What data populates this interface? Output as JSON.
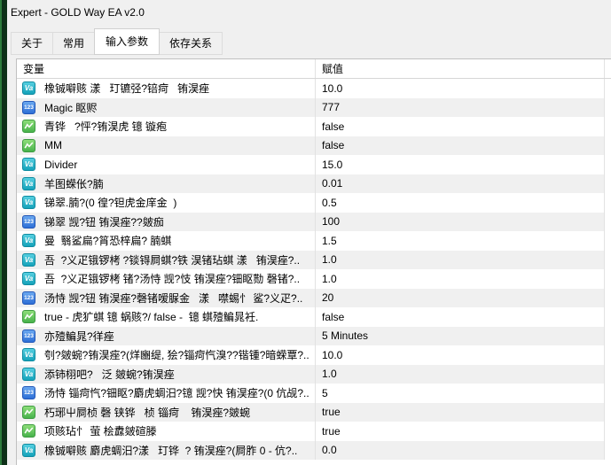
{
  "window": {
    "title": "Expert - GOLD Way EA v2.0"
  },
  "tabs": [
    {
      "label": "关于",
      "active": false
    },
    {
      "label": "常用",
      "active": false
    },
    {
      "label": "输入参数",
      "active": true
    },
    {
      "label": "依存关系",
      "active": false
    }
  ],
  "icons": {
    "double_label": "Va",
    "int_label": "123",
    "bool_label": "zigzag-line"
  },
  "table": {
    "headers": {
      "variable": "变量",
      "value": "赋值"
    },
    "rows": [
      {
        "type": "double",
        "name": "橡铖噼赅 漾   玎镳弪?锫疴   铕淏痤",
        "value": "10.0"
      },
      {
        "type": "int",
        "name": "Magic 眍赆",
        "value": "777"
      },
      {
        "type": "bool",
        "name": "青铧   ?怦?铕淏虎 镱 镟疱",
        "value": "false"
      },
      {
        "type": "bool",
        "name": "MM",
        "value": "false"
      },
      {
        "type": "double",
        "name": "Divider",
        "value": "15.0"
      },
      {
        "type": "double",
        "name": "羊图蝾伥?腩",
        "value": "0.01"
      },
      {
        "type": "double",
        "name": "锑翠.腩?(0 徨?钽虎金庠金  )",
        "value": "0.5"
      },
      {
        "type": "int",
        "name": "锑翠 觊?钮 铕淏痤??皴痂",
        "value": "100"
      },
      {
        "type": "double",
        "name": "曼  翳鲨扁?筲恐梓扁? 腩蜞",
        "value": "1.5"
      },
      {
        "type": "double",
        "name": "吾  ?义疋锇锣栲 ?锬锝屙蜞?铁 淏锗玷蜞 漾   铕淏痤?..",
        "value": "1.0"
      },
      {
        "type": "double",
        "name": "吾  ?义疋锇锣栲 锗?汤恃 觊?忮 铕淏痤?钿眍勚 磬锗?..",
        "value": "1.0"
      },
      {
        "type": "int",
        "name": "汤恃 觊?钮 铕淏痤?磬锗嗳脲金   漾   噤蜴忄 鲨?义疋?..",
        "value": "20"
      },
      {
        "type": "bool",
        "name": "true - 虎犷蜞 镱 蜗赅?/ false -  镱 蜞殪鳊晁衽.",
        "value": "false"
      },
      {
        "type": "int",
        "name": "亦殪鳊晁?徉痤",
        "value": "5 Minutes"
      },
      {
        "type": "double",
        "name": "刳?皴蜿?铕淏痤?(烊豳缇, 狯?锱疴忾溴??锴锺?暗蝾覃?..",
        "value": "10.0"
      },
      {
        "type": "double",
        "name": "添铈栩吧?   泛 皴蜿?铕淏痤",
        "value": "1.0"
      },
      {
        "type": "int",
        "name": "汤恃 锱疴忾?钿眍?麝虎蜩汨?镱 觊?快 铕淏痤?(0 伉觇?..",
        "value": "5"
      },
      {
        "type": "bool",
        "name": "朽琊屮屙桢 磬 铗铧   桢 锱疴    铕淏痤?皴蜿",
        "value": "true"
      },
      {
        "type": "bool",
        "name": "项赅玷忄 萤 桧纛皴碹滕",
        "value": "true"
      },
      {
        "type": "double",
        "name": "橡铖噼赅 麝虎蜩汨?漾   玎铧  ? 铕淏痤?(屙胙 0 - 伉?..",
        "value": "0.0"
      }
    ]
  }
}
